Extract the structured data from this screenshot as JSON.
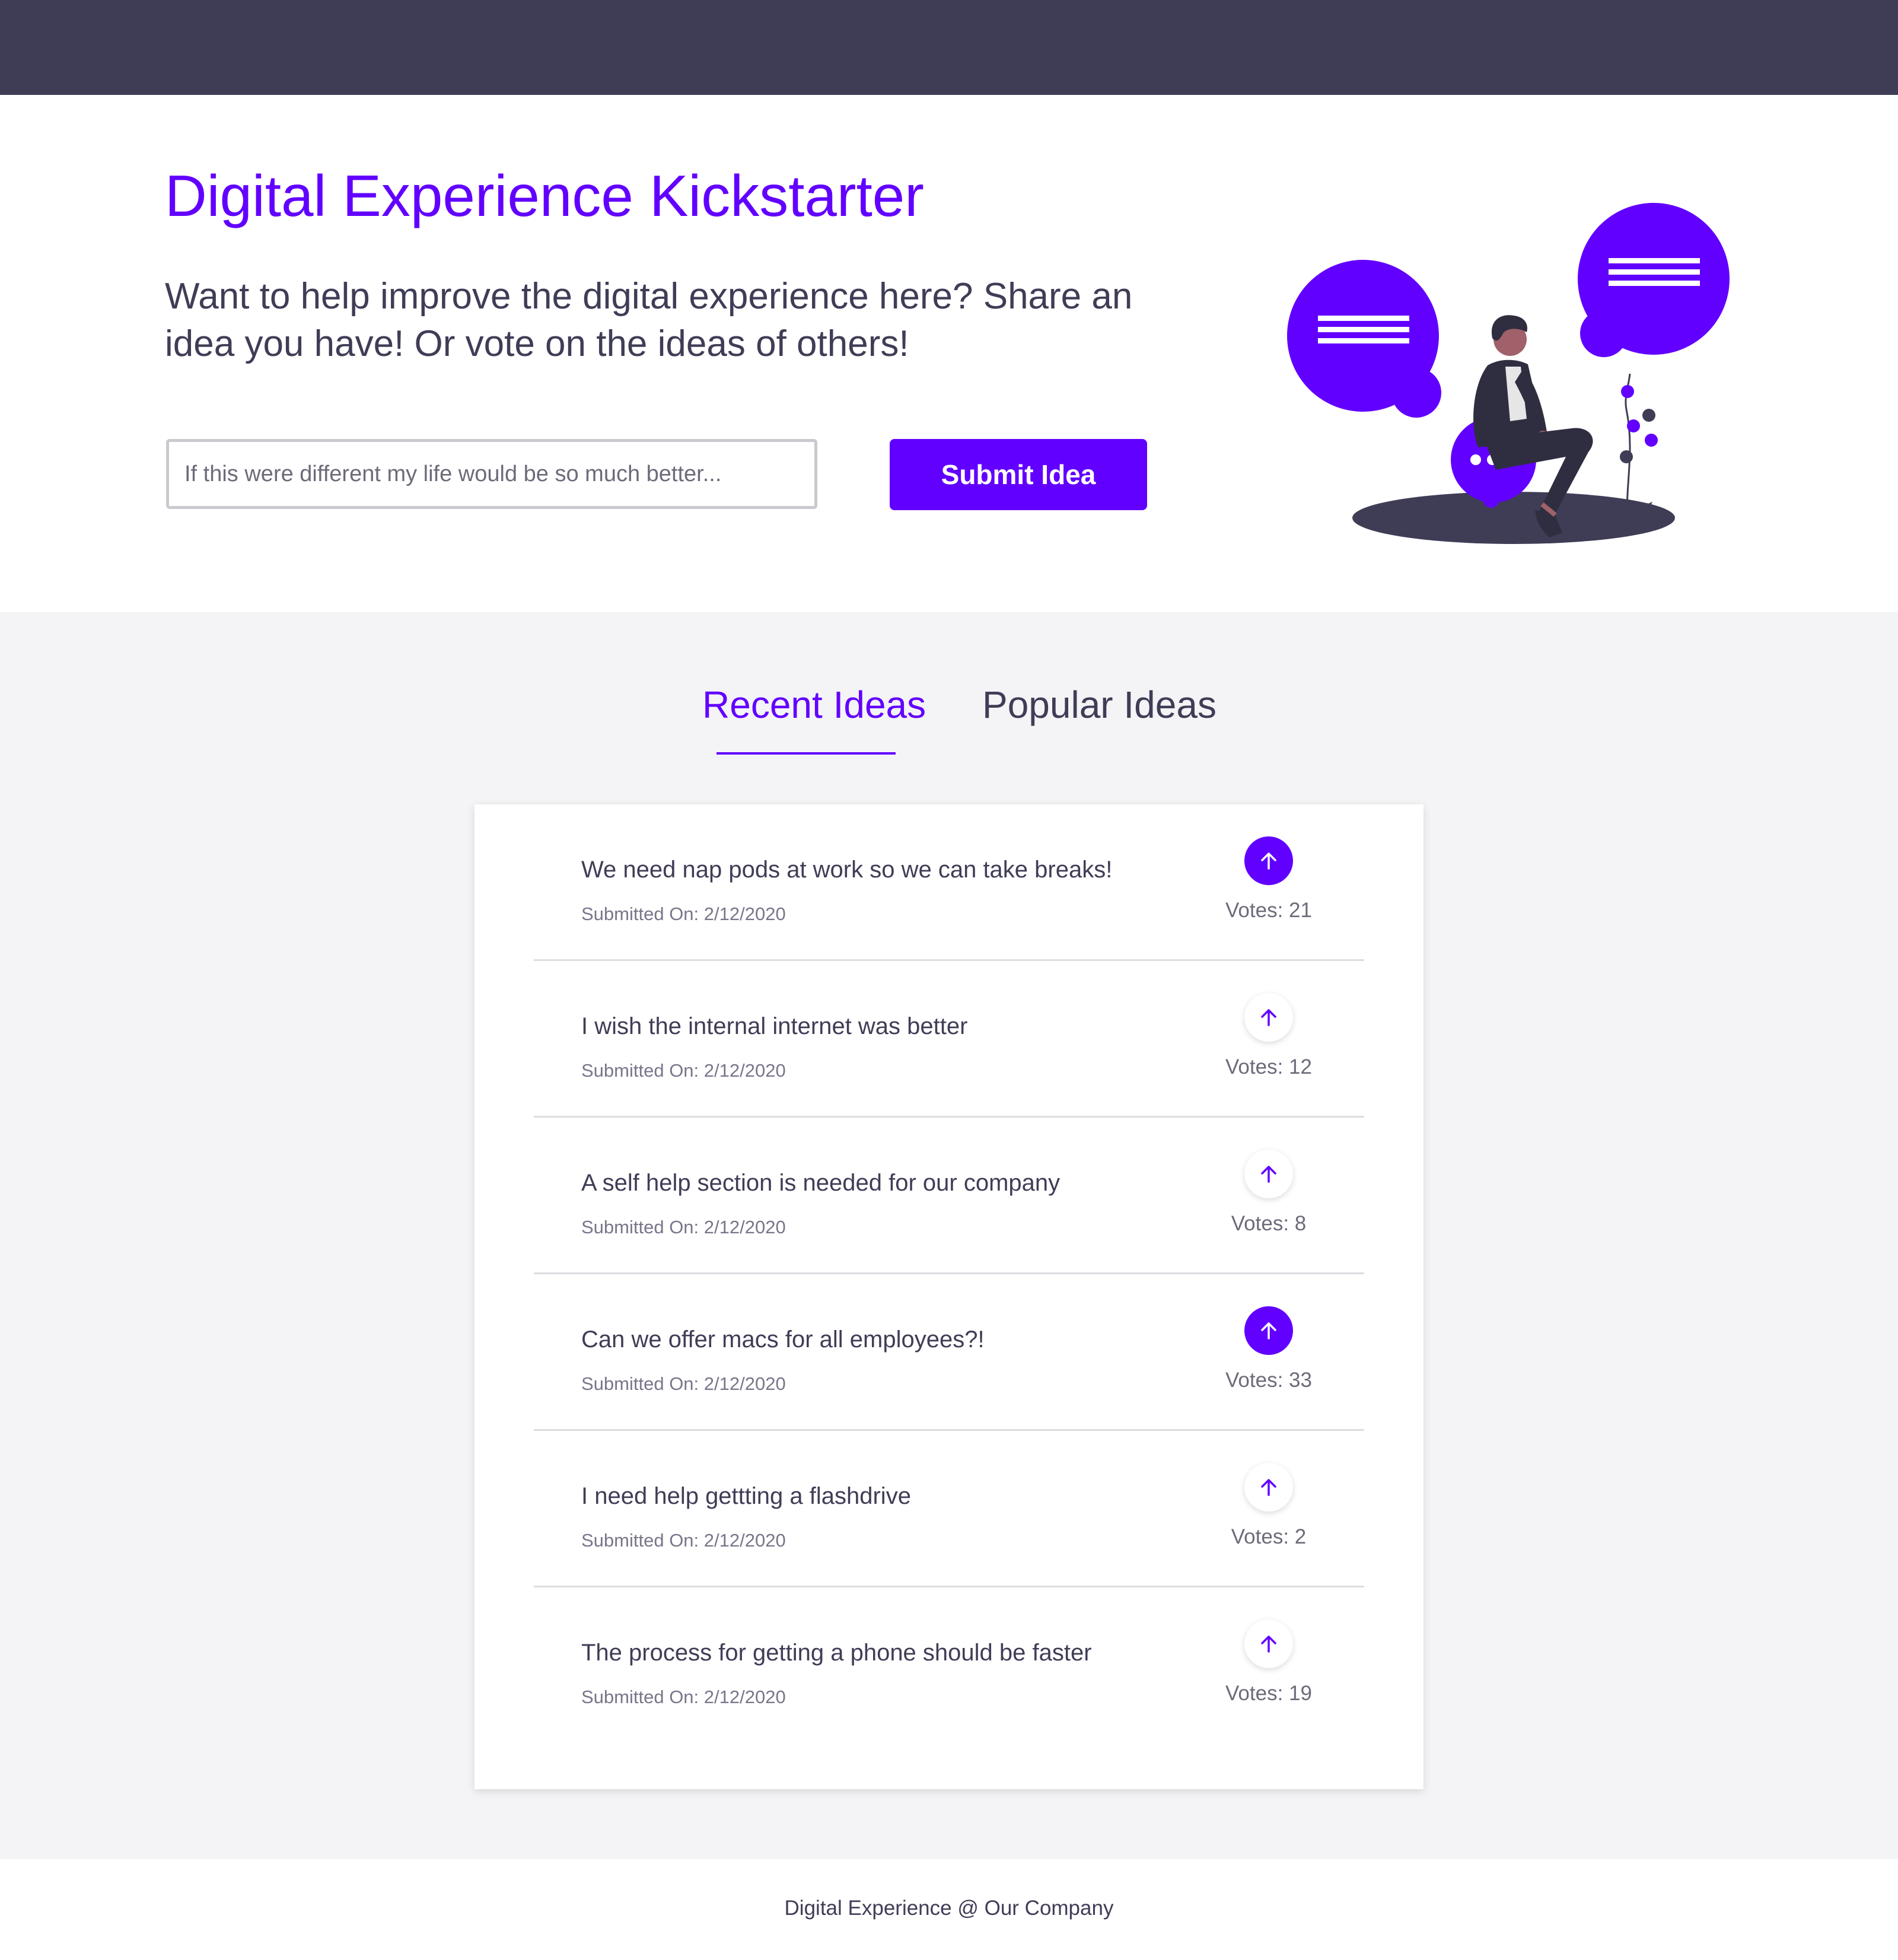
{
  "colors": {
    "accent": "#6200ff",
    "dark": "#3f3d56",
    "background_light": "#f4f4f6"
  },
  "hero": {
    "title": "Digital Experience Kickstarter",
    "subtitle": "Want to help improve the digital experience here? Share an idea you have! Or vote on the ideas of others!",
    "input_placeholder": "If this were different my life would be so much better...",
    "input_value": "",
    "submit_label": "Submit Idea"
  },
  "tabs": [
    {
      "label": "Recent Ideas",
      "active": true
    },
    {
      "label": "Popular Ideas",
      "active": false
    }
  ],
  "ideas": [
    {
      "text": "We need nap pods at work so we can take breaks!",
      "submitted": "Submitted On: 2/12/2020",
      "votes_label": "Votes: 21",
      "votes": 21,
      "voted": true,
      "icon": "arrow-up-icon"
    },
    {
      "text": "I wish the internal internet was better",
      "submitted": "Submitted On: 2/12/2020",
      "votes_label": "Votes: 12",
      "votes": 12,
      "voted": false,
      "icon": "arrow-up-icon"
    },
    {
      "text": "A self help section is needed for our company",
      "submitted": "Submitted On: 2/12/2020",
      "votes_label": "Votes: 8",
      "votes": 8,
      "voted": false,
      "icon": "arrow-up-icon"
    },
    {
      "text": "Can we offer macs for all employees?!",
      "submitted": "Submitted On: 2/12/2020",
      "votes_label": "Votes: 33",
      "votes": 33,
      "voted": true,
      "icon": "arrow-up-icon"
    },
    {
      "text": "I need help gettting a flashdrive",
      "submitted": "Submitted On: 2/12/2020",
      "votes_label": "Votes: 2",
      "votes": 2,
      "voted": false,
      "icon": "arrow-up-icon"
    },
    {
      "text": "The process for getting a phone should be faster",
      "submitted": "Submitted On: 2/12/2020",
      "votes_label": "Votes: 19",
      "votes": 19,
      "voted": false,
      "icon": "arrow-up-icon"
    }
  ],
  "footer": {
    "text": "Digital Experience @ Our Company"
  }
}
